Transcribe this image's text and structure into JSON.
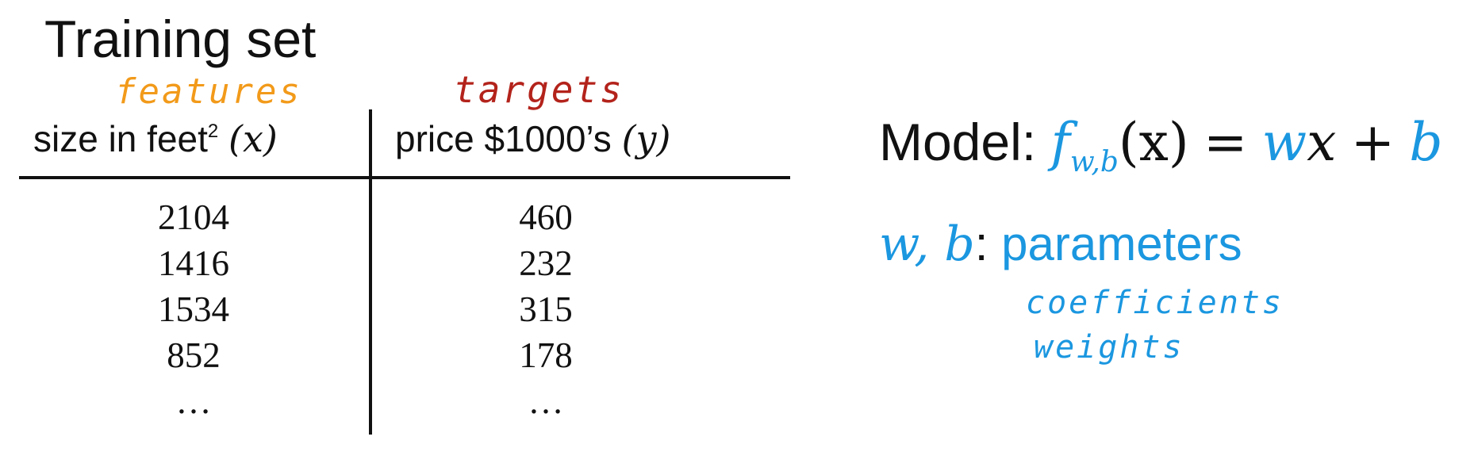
{
  "title": "Training set",
  "annotations": {
    "features": "features",
    "targets": "targets"
  },
  "table": {
    "size_header": {
      "text": "size in feet",
      "superscript": "2",
      "var": "(x)"
    },
    "price_header": {
      "text": "price $1000’s",
      "var": "(y)"
    },
    "rows": [
      {
        "size": "2104",
        "price": "460"
      },
      {
        "size": "1416",
        "price": "232"
      },
      {
        "size": "1534",
        "price": "315"
      },
      {
        "size": "852",
        "price": "178"
      },
      {
        "size": "…",
        "price": "…"
      }
    ]
  },
  "model": {
    "label": "Model:",
    "f": "f",
    "f_subscript": "w,b",
    "arg": "(x)",
    "equals": "=",
    "w": "w",
    "x": "x",
    "plus": "+",
    "b": "b"
  },
  "parameters": {
    "symbols": "w, b",
    "colon": ":",
    "label": "parameters",
    "alt_names": [
      "coefficients",
      "weights"
    ]
  },
  "colors": {
    "text": "#111111",
    "accent_blue": "#1b97e0",
    "features_orange": "#f29a1a",
    "targets_red": "#b3231b"
  }
}
